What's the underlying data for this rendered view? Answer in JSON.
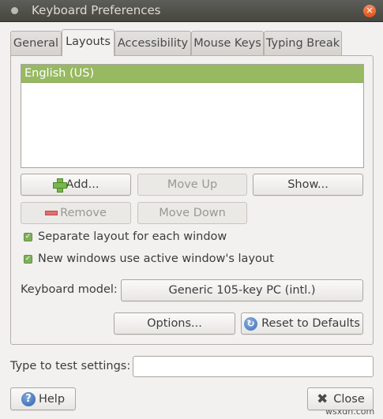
{
  "window": {
    "title": "Keyboard Preferences"
  },
  "tabs": [
    {
      "label": "General"
    },
    {
      "label": "Layouts"
    },
    {
      "label": "Accessibility"
    },
    {
      "label": "Mouse Keys"
    },
    {
      "label": "Typing Break"
    }
  ],
  "layouts": {
    "items": [
      "English (US)"
    ]
  },
  "buttons": {
    "add": "Add...",
    "move_up": "Move Up",
    "show": "Show...",
    "remove": "Remove",
    "move_down": "Move Down",
    "options": "Options...",
    "reset": "Reset to Defaults",
    "help": "Help",
    "close": "Close"
  },
  "checks": [
    {
      "label": "Separate layout for each window",
      "checked": true
    },
    {
      "label": "New windows use active window's layout",
      "checked": true
    }
  ],
  "keyboard_model": {
    "label": "Keyboard model:",
    "value": "Generic 105-key PC (intl.)"
  },
  "test": {
    "label": "Type to test settings:",
    "value": ""
  },
  "watermark": "wsxdn.com",
  "colors": {
    "selection": "#97b961",
    "titlebar": "#4f4f4a",
    "close_button": "#e9622a"
  },
  "icons": {
    "add": "plus-icon",
    "remove": "minus-icon",
    "reset": "reset-icon",
    "help": "help-icon",
    "close": "close-x-icon"
  }
}
